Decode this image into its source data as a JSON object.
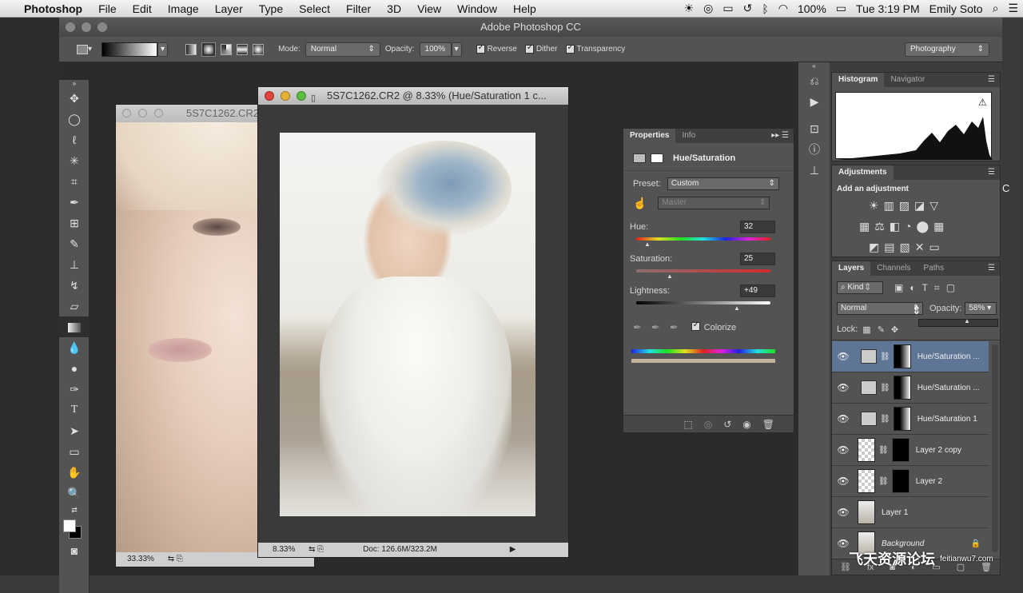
{
  "menubar": {
    "app": "Photoshop",
    "items": [
      "File",
      "Edit",
      "Image",
      "Layer",
      "Type",
      "Select",
      "Filter",
      "3D",
      "View",
      "Window",
      "Help"
    ],
    "battery": "100%",
    "time": "Tue 3:19 PM",
    "user": "Emily Soto"
  },
  "window": {
    "title": "Adobe Photoshop CC"
  },
  "options": {
    "mode_label": "Mode:",
    "mode_value": "Normal",
    "opacity_label": "Opacity:",
    "opacity_value": "100%",
    "reverse": "Reverse",
    "dither": "Dither",
    "transparency": "Transparency",
    "workspace": "Photography"
  },
  "doc_back": {
    "title": "5S7C1262.CR2",
    "zoom": "33.33%"
  },
  "doc_front": {
    "title": "5S7C1262.CR2 @ 8.33% (Hue/Saturation 1 c...",
    "zoom": "8.33%",
    "doc_info": "Doc: 126.6M/323.2M"
  },
  "properties": {
    "tabs": [
      "Properties",
      "Info"
    ],
    "adj_name": "Hue/Saturation",
    "preset_label": "Preset:",
    "preset_value": "Custom",
    "channel_value": "Master",
    "hue_label": "Hue:",
    "hue_value": "32",
    "sat_label": "Saturation:",
    "sat_value": "25",
    "light_label": "Lightness:",
    "light_value": "+49",
    "colorize": "Colorize"
  },
  "histogram": {
    "tabs": [
      "Histogram",
      "Navigator"
    ]
  },
  "adjustments": {
    "tab": "Adjustments",
    "heading": "Add an adjustment"
  },
  "layers_panel": {
    "tabs": [
      "Layers",
      "Channels",
      "Paths"
    ],
    "kind": "Kind",
    "blend": "Normal",
    "opacity_label": "Opacity:",
    "opacity_value": "58%",
    "lock_label": "Lock:",
    "layers": [
      {
        "name": "Hue/Saturation ...",
        "type": "adj",
        "selected": true
      },
      {
        "name": "Hue/Saturation ...",
        "type": "adj",
        "selected": false
      },
      {
        "name": "Hue/Saturation 1",
        "type": "adj",
        "selected": false
      },
      {
        "name": "Layer 2 copy",
        "type": "pixel",
        "selected": false
      },
      {
        "name": "Layer 2",
        "type": "pixel",
        "selected": false
      },
      {
        "name": "Layer 1",
        "type": "photo",
        "selected": false
      },
      {
        "name": "Background",
        "type": "photo",
        "selected": false
      }
    ]
  },
  "watermark": {
    "text": "飞天资源论坛",
    "url": "feitianwu7.com"
  }
}
